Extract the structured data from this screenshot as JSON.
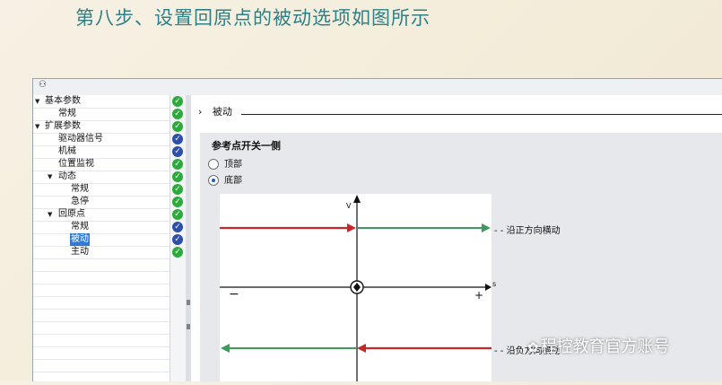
{
  "slide": {
    "title": "第八步、设置回原点的被动选项如图所示"
  },
  "toolbar": {
    "icon": "tree-view-icon"
  },
  "tree": {
    "items": [
      {
        "label": "基本参数",
        "expanded": true,
        "status": "ok"
      },
      {
        "label": "常规",
        "status": "ok"
      },
      {
        "label": "扩展参数",
        "expanded": true,
        "status": "ok"
      },
      {
        "label": "驱动器信号",
        "status": "info"
      },
      {
        "label": "机械",
        "status": "info"
      },
      {
        "label": "位置监视",
        "status": "ok"
      },
      {
        "label": "动态",
        "expanded": true,
        "status": "ok"
      },
      {
        "label": "常规",
        "status": "ok"
      },
      {
        "label": "急停",
        "status": "ok"
      },
      {
        "label": "回原点",
        "expanded": true,
        "status": "ok"
      },
      {
        "label": "常规",
        "status": "info"
      },
      {
        "label": "被动",
        "status": "info",
        "selected": true
      },
      {
        "label": "主动",
        "status": "ok"
      }
    ]
  },
  "section": {
    "arrow": "›",
    "title": "被动"
  },
  "panel": {
    "title": "参考点开关一侧",
    "options": [
      {
        "label": "顶部",
        "checked": false
      },
      {
        "label": "底部",
        "checked": true
      }
    ]
  },
  "diagram": {
    "y_axis_label": "V",
    "x_axis_label": "s",
    "minus": "−",
    "plus": "+",
    "callout_top": "沿正方向横动",
    "callout_bottom": "沿负方向横动"
  },
  "watermark": {
    "text": "程控教育官方账号"
  },
  "colors": {
    "ok": "#2eaa3c",
    "info": "#2e4fa8",
    "red": "#c8262b",
    "green": "#3c9a5a",
    "accent": "#2f7f86"
  }
}
